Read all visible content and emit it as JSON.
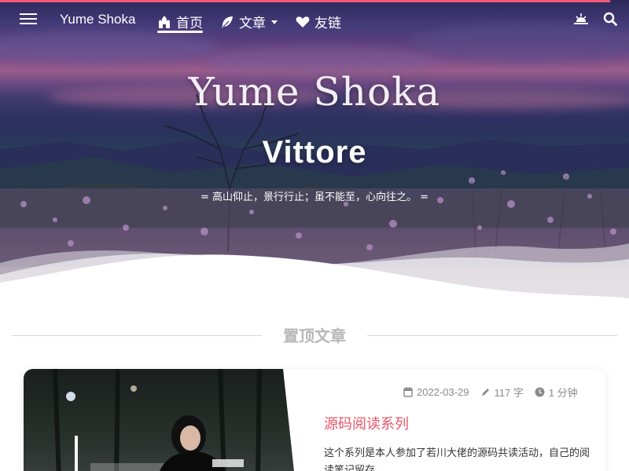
{
  "navbar": {
    "brand": "Yume Shoka",
    "items": [
      {
        "label": "首页",
        "icon": "castle-icon",
        "active": true
      },
      {
        "label": "文章",
        "icon": "feather-icon",
        "has_dropdown": true
      },
      {
        "label": "友链",
        "icon": "heart-icon"
      }
    ],
    "right_icons": [
      "theme-sunrise-icon",
      "search-icon"
    ]
  },
  "hero": {
    "title": "Yume Shoka",
    "subtitle": "Vittore",
    "motto": "= 高山仰止，景行行止；虽不能至，心向往之。 ="
  },
  "section": {
    "heading": "置顶文章"
  },
  "pinned_post": {
    "date": "2022-03-29",
    "word_count": "117 字",
    "read_time": "1 分钟",
    "title": "源码阅读系列",
    "excerpt": "这个系列是本人参加了若川大佬的源码共读活动，自己的阅读笔记留存。"
  },
  "colors": {
    "accent": "#e9546b",
    "top_bar": "#ef5a7a"
  }
}
